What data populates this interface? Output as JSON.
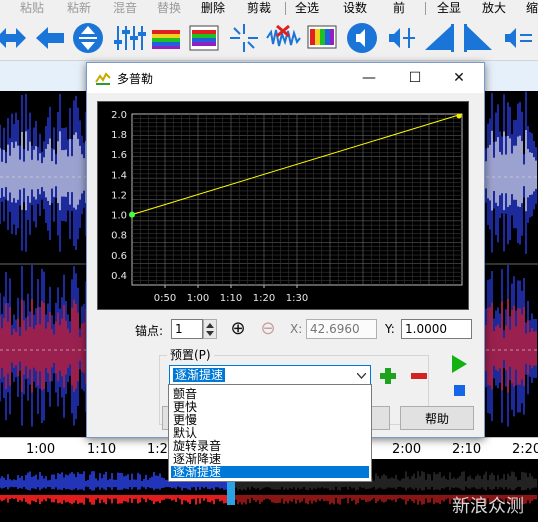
{
  "toolbar": {
    "labels": [
      {
        "text": "粘贴",
        "disabled": true
      },
      {
        "text": "粘新",
        "disabled": true
      },
      {
        "text": "混音",
        "disabled": true
      },
      {
        "text": "替换",
        "disabled": true
      },
      {
        "text": "删除",
        "disabled": false
      },
      {
        "text": "剪裁",
        "disabled": false
      },
      {
        "text": "全选",
        "disabled": false
      },
      {
        "text": "设数",
        "disabled": false
      },
      {
        "text": "前",
        "disabled": false
      },
      {
        "text": "全显",
        "disabled": false
      },
      {
        "text": "放大",
        "disabled": false
      },
      {
        "text": "缩",
        "disabled": false
      }
    ],
    "icons": [
      "arrows-icon",
      "arrow-left-icon",
      "expand-vertical-icon",
      "equalizer-icon",
      "spectrum-icon",
      "spectrum-grid-icon",
      "sparkle-icon",
      "wave-cut-icon",
      "color-bar-icon",
      "speaker-icon",
      "speaker-mid-icon",
      "fade-in-icon",
      "fade-out-icon",
      "speaker-eq-icon"
    ]
  },
  "timeline": {
    "labels": [
      "1:00",
      "1:10",
      "1:20",
      "2:00",
      "2:10",
      "2:20"
    ]
  },
  "watermark": "新浪众测",
  "dialog": {
    "title": "多普勒",
    "minimize": "—",
    "maximize": "☐",
    "close": "✕",
    "chart_data": {
      "type": "line",
      "x_ticks": [
        "0:50",
        "1:00",
        "1:10",
        "1:20",
        "1:30"
      ],
      "y_ticks": [
        "2.0",
        "1.8",
        "1.6",
        "1.4",
        "1.2",
        "1.0",
        "0.8",
        "0.6",
        "0.4"
      ],
      "ylim": [
        0.3,
        2.0
      ],
      "points": [
        {
          "x": 0.0,
          "y": 1.0
        },
        {
          "x": 1.0,
          "y": 2.0
        }
      ],
      "line_color": "#ffff00",
      "grid": true
    },
    "anchor_label": "锚点:",
    "anchor_value": "1",
    "add_icon": "⊕",
    "remove_icon": "⊖",
    "x_label": "X:",
    "x_value": "42.6960",
    "y_label": "Y:",
    "y_value": "1.0000",
    "preset_label": "预置(P)",
    "preset_value": "逐渐提速",
    "preset_options": [
      "颤音",
      "更快",
      "更慢",
      "默认",
      "旋转录音",
      "逐渐降速",
      "逐渐提速"
    ],
    "selected_index": 6,
    "help_label": "帮助",
    "colors": {
      "play": "#12b212",
      "stop": "#1565e8",
      "add": "#1fa31f",
      "remove": "#d22222",
      "select": "#0078d7"
    }
  }
}
